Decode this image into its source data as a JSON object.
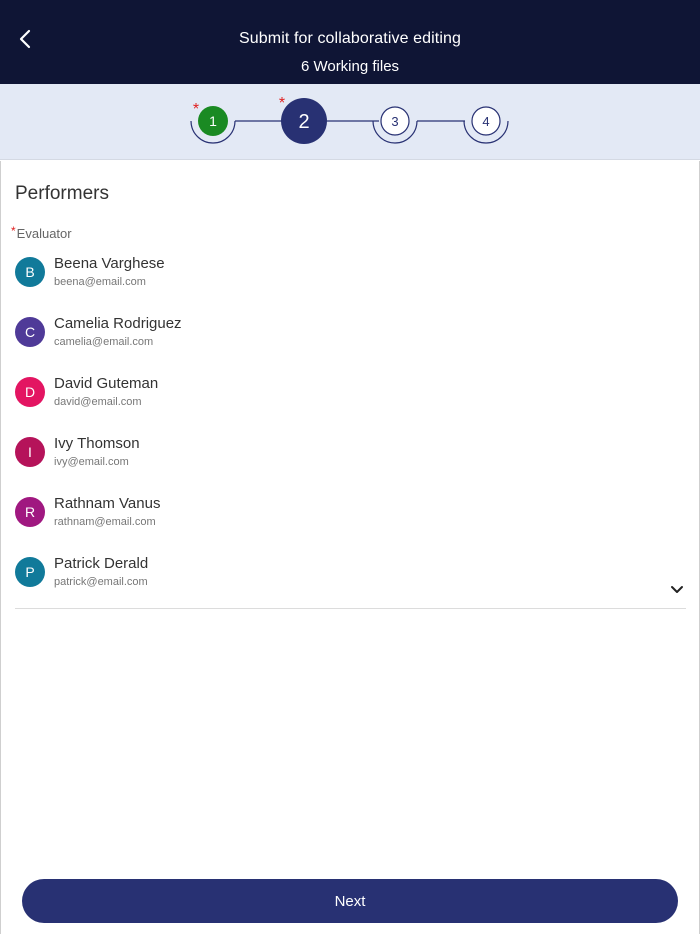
{
  "header": {
    "title": "Submit for collaborative editing",
    "subtitle": "6 Working files"
  },
  "stepper": {
    "steps": [
      {
        "label": "1",
        "state": "completed",
        "required": true
      },
      {
        "label": "2",
        "state": "current",
        "required": true
      },
      {
        "label": "3",
        "state": "pending",
        "required": false
      },
      {
        "label": "4",
        "state": "pending",
        "required": false
      }
    ],
    "required_mark": "*"
  },
  "performers": {
    "title": "Performers",
    "evaluator_label": "Evaluator",
    "required_mark": "*",
    "people": [
      {
        "initial": "B",
        "name": "Beena Varghese",
        "email": "beena@email.com",
        "color": "#117a9a"
      },
      {
        "initial": "C",
        "name": "Camelia Rodriguez",
        "email": "camelia@email.com",
        "color": "#4f3a98"
      },
      {
        "initial": "D",
        "name": "David Guteman",
        "email": "david@email.com",
        "color": "#e31562"
      },
      {
        "initial": "I",
        "name": "Ivy Thomson",
        "email": "ivy@email.com",
        "color": "#b5135a"
      },
      {
        "initial": "R",
        "name": "Rathnam Vanus",
        "email": "rathnam@email.com",
        "color": "#a01880"
      },
      {
        "initial": "P",
        "name": "Patrick Derald",
        "email": "patrick@email.com",
        "color": "#117a9a"
      }
    ]
  },
  "footer": {
    "next_label": "Next"
  },
  "colors": {
    "header_bg": "#0f1535",
    "stepper_bg": "#e3e9f5",
    "step_completed": "#1a8a23",
    "step_current": "#283173",
    "accent": "#283173"
  }
}
